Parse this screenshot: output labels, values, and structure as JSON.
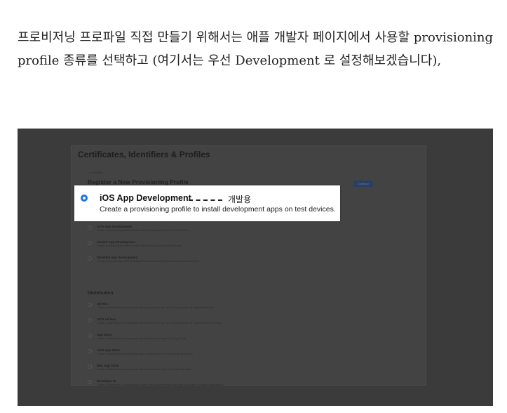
{
  "article": {
    "paragraph": "프로비저닝 프로파일 직접 만들기 위해서는 애플 개발자 페이지에서 사용할 provisioning profile 종류를 선택하고 (여기서는 우선 Development 로 설정해보겠습니다),"
  },
  "screenshot": {
    "page_title": "Certificates, Identifiers & Profiles",
    "breadcrumb": "< All Profiles",
    "section_title": "Register a New Provisioning Profile",
    "continue_label": "Continue",
    "highlight": {
      "name": "iOS App Development",
      "annotation": "개발용",
      "description": "Create a provisioning profile to install development apps on test devices."
    },
    "development_options": [
      {
        "name": "tvOS App Development",
        "desc": "Create a provisioning profile to install development apps on tvOS test devices."
      },
      {
        "name": "macOS App Development",
        "desc": "Create a provisioning profile to install development apps on test devices."
      },
      {
        "name": "DriverKit App Development",
        "desc": "Create a provisioning profile to install development DriverKit processes on test devices."
      }
    ],
    "distribution_title": "Distribution",
    "distribution_options": [
      {
        "name": "Ad Hoc",
        "desc": "Create a distribution provisioning profile to install your app on a limited number of registered devices."
      },
      {
        "name": "tvOS Ad Hoc",
        "desc": "Create a distribution provisioning profile to install your app on a limited number of registered tvOS devices."
      },
      {
        "name": "App Store",
        "desc": "Create a distribution provisioning profile to submit your app to the App Store."
      },
      {
        "name": "tvOS App Store",
        "desc": "Create a distribution provisioning profile to submit your tvOS app to the App Store."
      },
      {
        "name": "Mac App Store",
        "desc": "Create a distribution provisioning profile to submit your app to the Mac App Store."
      },
      {
        "name": "Developer ID",
        "desc": "Create a Developer ID provisioning profile to use Apple services with your Developer ID signed applications."
      }
    ]
  }
}
